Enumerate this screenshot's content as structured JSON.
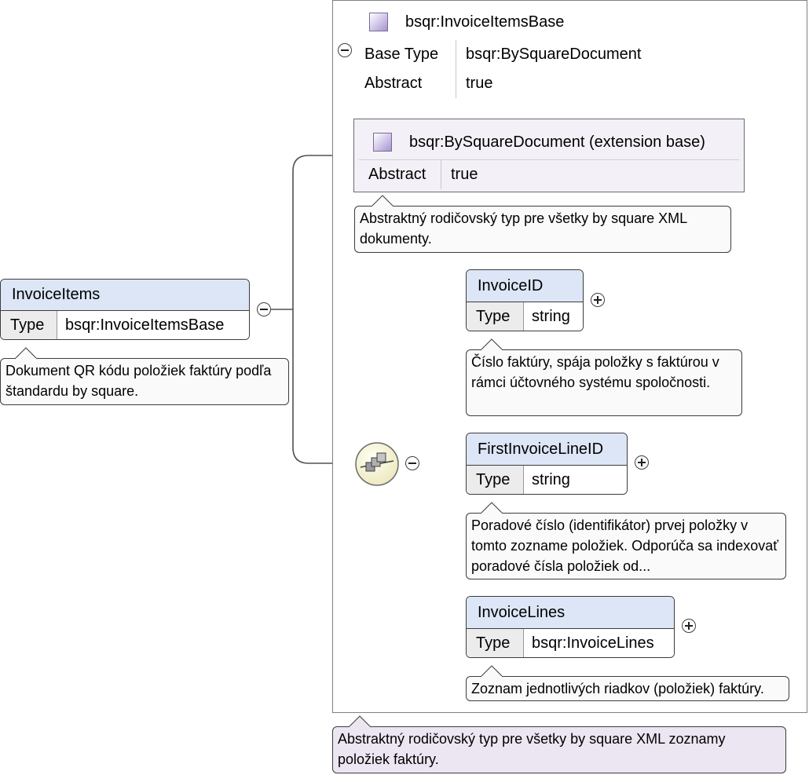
{
  "base_type": {
    "name": "bsqr:InvoiceItemsBase",
    "props": [
      {
        "key": "Base Type",
        "value": "bsqr:BySquareDocument"
      },
      {
        "key": "Abstract",
        "value": "true"
      }
    ]
  },
  "extension_base": {
    "name": "bsqr:BySquareDocument (extension base)",
    "props": [
      {
        "key": "Abstract",
        "value": "true"
      }
    ],
    "annotation": "Abstraktný rodičovský typ pre všetky by square XML dokumenty."
  },
  "root": {
    "name": "InvoiceItems",
    "type_label": "Type",
    "type_value": "bsqr:InvoiceItemsBase",
    "annotation": "Dokument QR kódu položiek faktúry podľa štandardu by square."
  },
  "children": [
    {
      "name": "InvoiceID",
      "type_label": "Type",
      "type_value": "string",
      "annotation": "Číslo faktúry, spája položky s faktúrou v rámci účtovného systému spoločnosti."
    },
    {
      "name": "FirstInvoiceLineID",
      "type_label": "Type",
      "type_value": "string",
      "annotation": "Poradové číslo (identifikátor) prvej položky v tomto zozname položiek. Odporúča sa indexovať poradové čísla položiek od..."
    },
    {
      "name": "InvoiceLines",
      "type_label": "Type",
      "type_value": "bsqr:InvoiceLines",
      "annotation": "Zoznam jednotlivých riadkov (položiek) faktúry."
    }
  ],
  "frame_annotation": "Abstraktný rodičovský typ pre všetky by square XML zoznamy položiek faktúry."
}
